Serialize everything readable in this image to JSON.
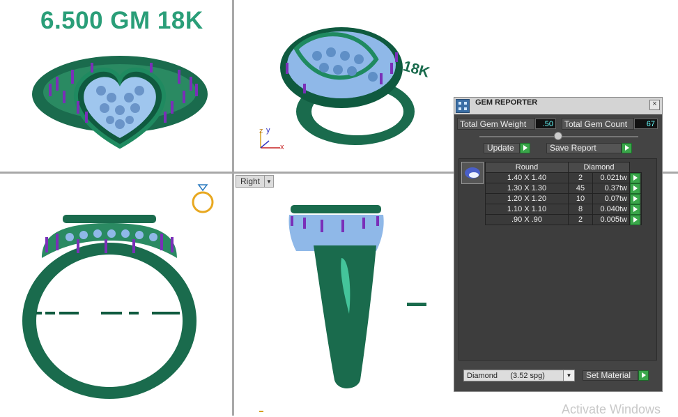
{
  "viewport_title": "6.500 GM 18K",
  "engraving_text": "18K",
  "view_label": "Right",
  "watermark": "Activate Windows",
  "gem_reporter": {
    "title": "GEM REPORTER",
    "close_glyph": "×",
    "total_gem_weight_label": "Total Gem Weight",
    "total_gem_weight_value": ".50",
    "total_gem_count_label": "Total Gem Count",
    "total_gem_count_value": "67",
    "update_label": "Update",
    "save_report_label": "Save Report",
    "table_headers": [
      "Round",
      "Diamond"
    ],
    "rows": [
      {
        "size": "1.40 X 1.40",
        "count": "2",
        "tw": "0.021tw"
      },
      {
        "size": "1.30 X 1.30",
        "count": "45",
        "tw": "0.37tw"
      },
      {
        "size": "1.20 X 1.20",
        "count": "10",
        "tw": "0.07tw"
      },
      {
        "size": "1.10 X 1.10",
        "count": "8",
        "tw": "0.040tw"
      },
      {
        "size": ".90 X .90",
        "count": "2",
        "tw": "0.005tw"
      }
    ],
    "material_select": "Diamond      (3.52 spg)",
    "set_material_label": "Set Material"
  },
  "axis_labels": {
    "y": "y",
    "z": "z",
    "x": "x"
  },
  "colors": {
    "title": "#2a9e78",
    "metal": "#1a6b4d",
    "gem": "#8fb8e8",
    "prong": "#7a2fb8",
    "panel_bg": "#444444",
    "go_button": "#3aa64a"
  }
}
